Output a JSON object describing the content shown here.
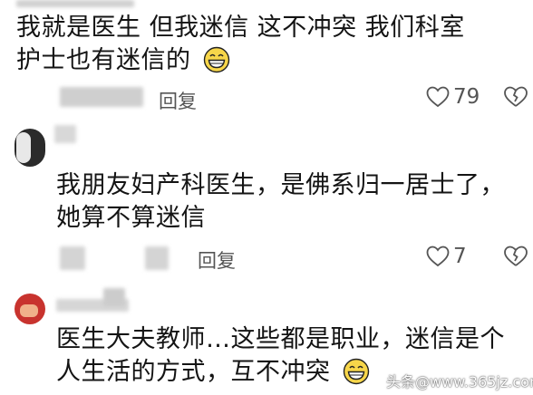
{
  "comments": [
    {
      "lines": [
        "我就是医生 但我迷信 这不冲突 我们科室",
        "护士也有迷信的"
      ],
      "emoji": "grinning-face-icon",
      "reply_label": "回复",
      "like_count": "79"
    },
    {
      "lines": [
        "我朋友妇产科医生，是佛系归一居士了，",
        "她算不算迷信"
      ],
      "reply_label": "回复",
      "like_count": "7"
    },
    {
      "lines": [
        "医生大夫教师…这些都是职业，迷信是个",
        "人生活的方式，互不冲突"
      ],
      "emoji": "grinning-face-icon"
    }
  ],
  "watermark": {
    "text": "头条@",
    "site": "www.365jz.com"
  },
  "colors": {
    "text": "#141414",
    "secondary": "#555555",
    "avatar2": "#2b2b2b",
    "avatar3": "#c8332e"
  }
}
